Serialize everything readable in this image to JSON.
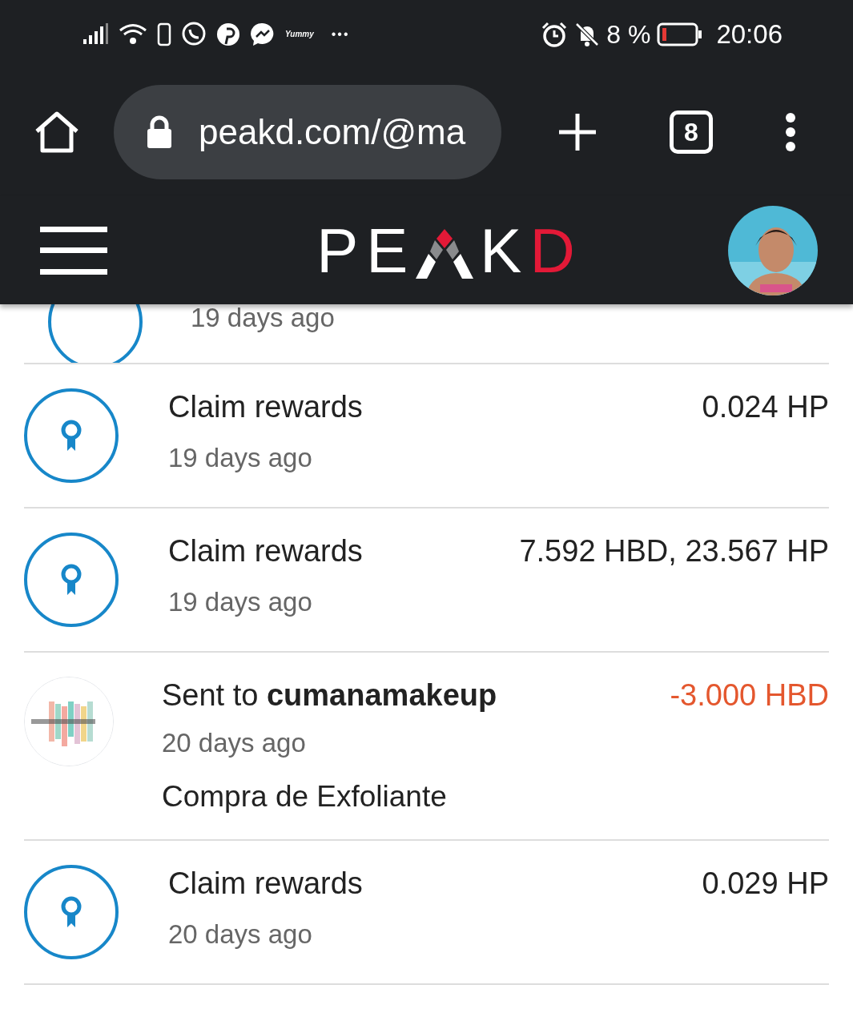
{
  "status_bar": {
    "app_label": "Yummy",
    "more": "•••",
    "battery": "8 %",
    "time": "20:06"
  },
  "browser": {
    "url": "peakd.com/@ma",
    "tab_count": "8"
  },
  "header": {
    "logo_start": "PE",
    "logo_k": "K",
    "logo_end": "D"
  },
  "transactions": [
    {
      "kind": "claim",
      "time": "19 days ago"
    },
    {
      "kind": "claim",
      "title": "Claim rewards",
      "time": "19 days ago",
      "amount": "0.024 HP"
    },
    {
      "kind": "claim",
      "title": "Claim rewards",
      "time": "19 days ago",
      "amount": "7.592 HBD, 23.567 HP"
    },
    {
      "kind": "transfer",
      "title": "Sent to **cumanamakeup**",
      "time": "20 days ago",
      "amount": "-3.000 HBD",
      "memo": "Compra de Exfoliante"
    },
    {
      "kind": "claim",
      "title": "Claim rewards",
      "time": "20 days ago",
      "amount": "0.029 HP"
    }
  ]
}
